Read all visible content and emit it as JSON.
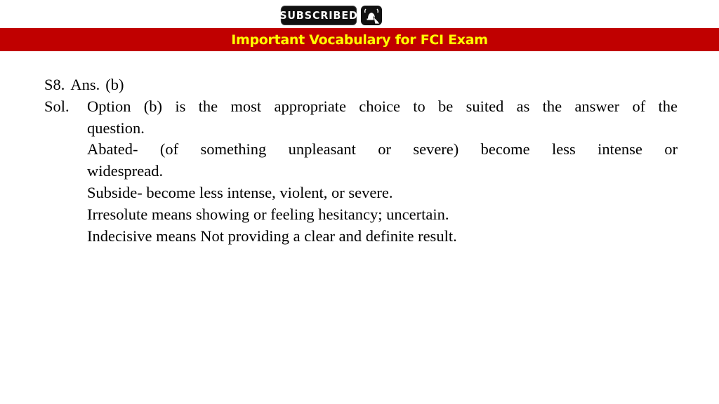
{
  "header": {
    "subscribe_badge": {
      "label": "SUBSCRIBED",
      "icon": "bell-ring-icon"
    },
    "banner_title": "Important Vocabulary for FCI Exam",
    "colors": {
      "banner_bg": "#c00000",
      "banner_text": "#ffff00"
    }
  },
  "solution": {
    "question_no": "S8.",
    "answer_label": "Ans.",
    "answer_value": "(b)",
    "sol_label": "Sol.",
    "lines": [
      {
        "text": "Option (b)  is the most appropriate choice to be suited as the answer of the",
        "justify": true
      },
      {
        "text": "question.",
        "justify": false
      },
      {
        "text": "Abated- (of something unpleasant or severe)  become less intense or",
        "justify": true
      },
      {
        "text": "widespread.",
        "justify": false
      },
      {
        "text": "Subside- become less intense, violent, or severe.",
        "justify": false
      },
      {
        "text": "Irresolute means showing or feeling hesitancy; uncertain.",
        "justify": false
      },
      {
        "text": "Indecisive means Not providing a clear and definite result.",
        "justify": false
      }
    ]
  }
}
